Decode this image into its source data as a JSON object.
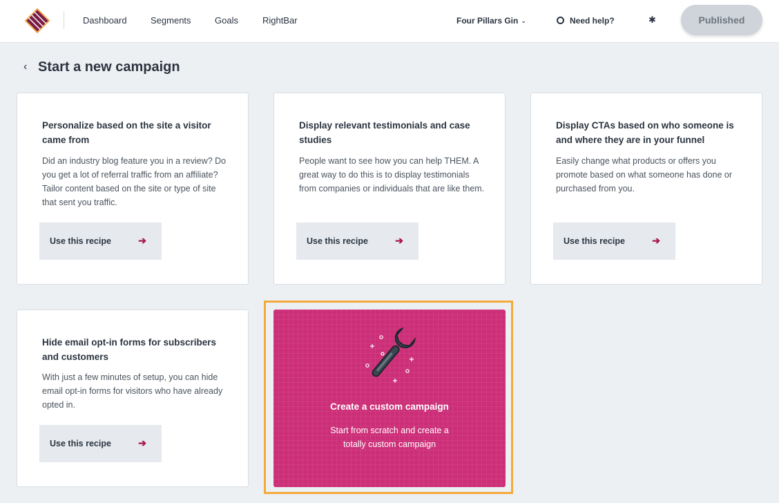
{
  "header": {
    "nav": [
      "Dashboard",
      "Segments",
      "Goals",
      "RightBar"
    ],
    "account_name": "Four Pillars Gin",
    "help_label": "Need help?",
    "published_label": "Published"
  },
  "page": {
    "back_glyph": "‹",
    "title": "Start a new campaign"
  },
  "recipes": [
    {
      "title": "Personalize based on the site a visitor came from",
      "description": "Did an industry blog feature you in a review? Do you get a lot of referral traffic from an affiliate? Tailor content based on the site or type of site that sent you traffic.",
      "button_label": "Use this recipe"
    },
    {
      "title": "Display relevant testimonials and case studies",
      "description": "People want to see how you can help THEM. A great way to do this is to display testimonials from companies or individuals that are like them.",
      "button_label": "Use this recipe"
    },
    {
      "title": "Display CTAs based on who someone is and where they are in your funnel",
      "description": "Easily change what products or offers you promote based on what someone has done or purchased from you.",
      "button_label": "Use this recipe"
    },
    {
      "title": "Hide email opt-in forms for subscribers and customers",
      "description": "With just a few minutes of setup, you can hide email opt-in forms for visitors who have already opted in.",
      "button_label": "Use this recipe"
    }
  ],
  "custom": {
    "title": "Create a custom campaign",
    "description": "Start from scratch and create a totally custom campaign"
  },
  "icons": {
    "arrow": "➔",
    "gear": "✱",
    "chevron": "⌄"
  },
  "colors": {
    "accent": "#cc2f78",
    "highlight": "#f4a93b",
    "arrow": "#a8154e"
  }
}
